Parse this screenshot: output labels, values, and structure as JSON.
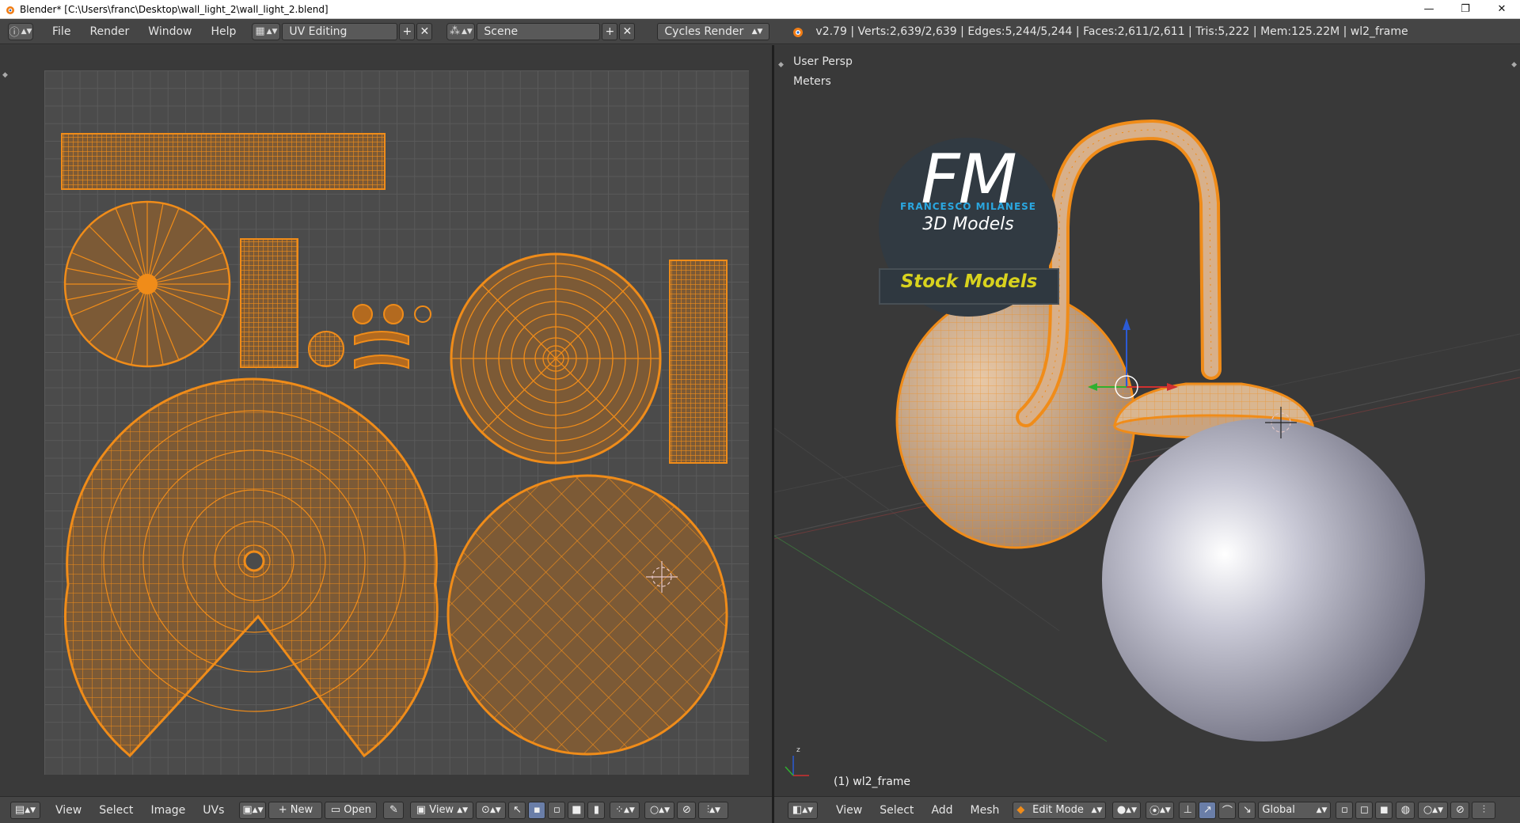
{
  "window": {
    "title": "Blender* [C:\\Users\\franc\\Desktop\\wall_light_2\\wall_light_2.blend]",
    "minimize": "—",
    "restore": "❐",
    "close": "✕"
  },
  "infobar": {
    "menus": [
      "File",
      "Render",
      "Window",
      "Help"
    ],
    "layout": "UV Editing",
    "scene": "Scene",
    "engine": "Cycles Render",
    "stats": "v2.79 | Verts:2,639/2,639 | Edges:5,244/5,244 | Faces:2,611/2,611 | Tris:5,222 | Mem:125.22M | wl2_frame"
  },
  "viewport": {
    "view_name": "User Persp",
    "units": "Meters",
    "object_label": "(1) wl2_frame"
  },
  "logo": {
    "monogram": "FM",
    "name": "FRANCESCO MILANESE",
    "tagline": "3D Models",
    "banner": "Stock Models"
  },
  "uv_header": {
    "menus": [
      "View",
      "Select",
      "Image",
      "UVs"
    ],
    "new_label": "New",
    "open_label": "Open",
    "view_label": "View"
  },
  "view3d_header": {
    "menus": [
      "View",
      "Select",
      "Add",
      "Mesh"
    ],
    "mode": "Edit Mode",
    "orientation": "Global"
  },
  "colors": {
    "uv_orange": "#f08c19",
    "uv_fill": "#7c5a36",
    "header_bg": "#454545",
    "logo_blue": "#2aa7e0",
    "logo_yellow": "#d8d21e"
  }
}
